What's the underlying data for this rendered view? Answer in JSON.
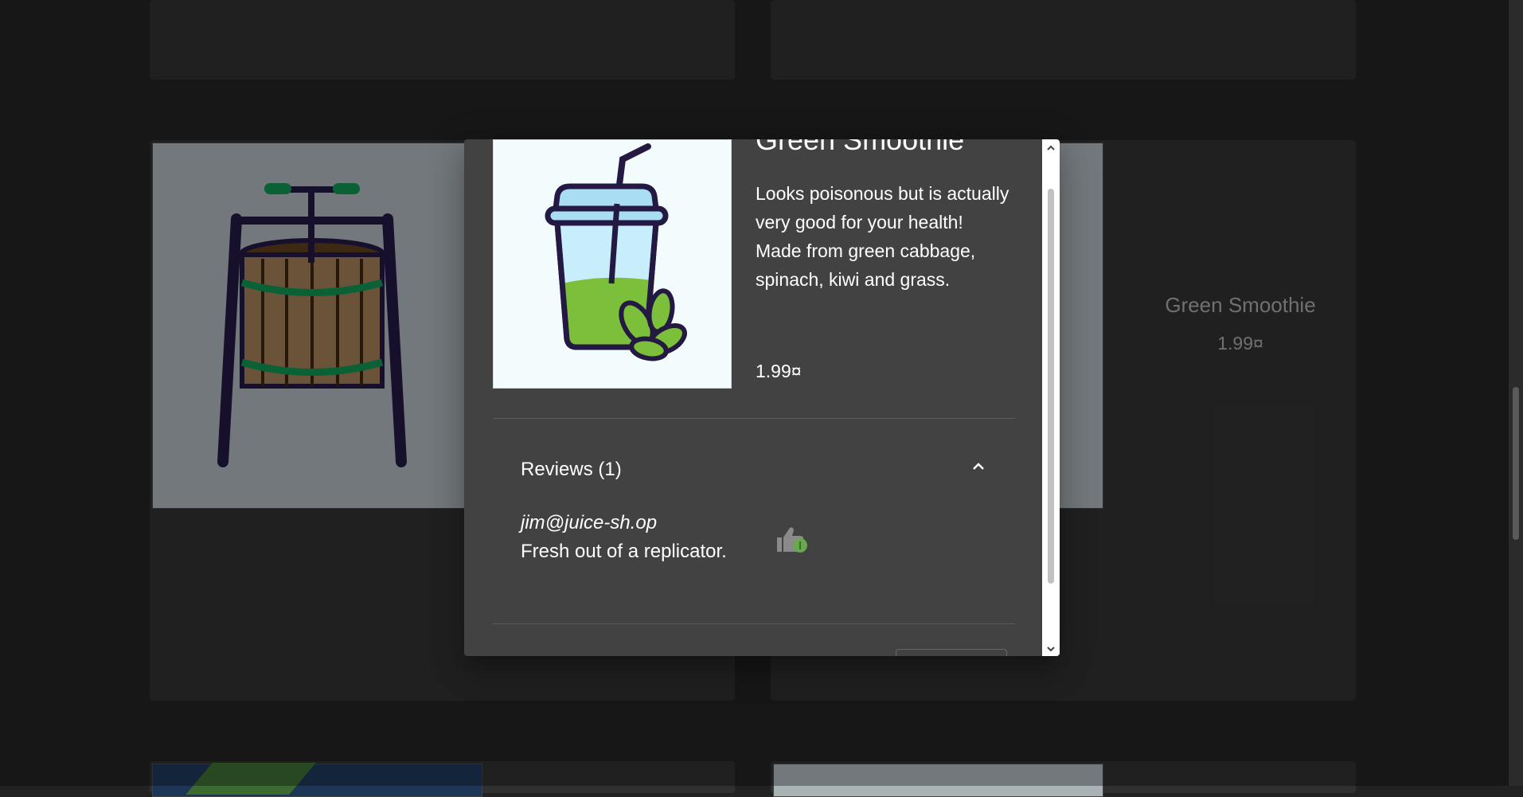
{
  "background_cards": {
    "right_card_name": "Green Smoothie",
    "right_card_price": "1.99¤"
  },
  "dialog": {
    "title": "Green Smoothie",
    "description": "Looks poisonous but is actually very good for your health! Made from green cabbage, spinach, kiwi and grass.",
    "price": "1.99¤",
    "reviews": {
      "header": "Reviews (1)",
      "items": [
        {
          "author": "jim@juice-sh.op",
          "text": "Fresh out of a replicator."
        }
      ]
    }
  },
  "icons": {
    "collapse": "chevron-up-icon",
    "like": "thumb-up-icon"
  },
  "colors": {
    "page_background": "#222222",
    "card_background": "#303030",
    "dialog_background": "#424242",
    "accent_green": "#6aa84f"
  }
}
